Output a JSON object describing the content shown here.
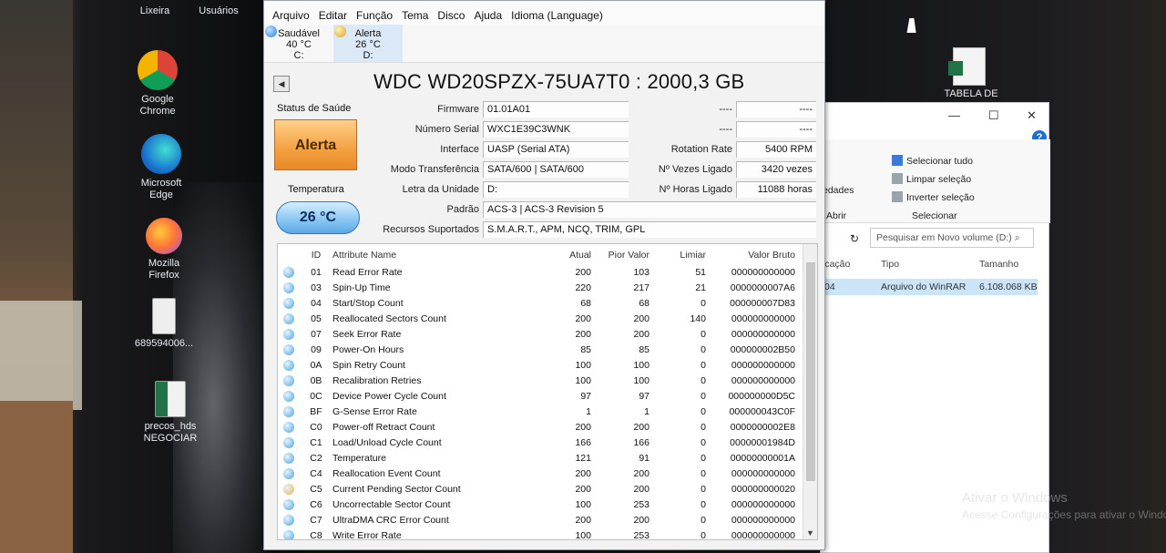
{
  "desktop": {
    "icons": [
      {
        "label1": "Lixeira",
        "label2": ""
      },
      {
        "label1": "Usuários",
        "label2": ""
      },
      {
        "label1": "Google",
        "label2": "Chrome"
      },
      {
        "label1": "Microsoft",
        "label2": "Edge"
      },
      {
        "label1": "Mozilla",
        "label2": "Firefox"
      },
      {
        "label1": "689594006...",
        "label2": ""
      },
      {
        "label1": "precos_hds",
        "label2": "NEGOCIAR"
      },
      {
        "label1": "TABELA DE",
        "label2": ""
      }
    ],
    "watermark": "Ativar o Windows",
    "watermark2": "Acesse Configurações para ativar o Windows."
  },
  "cdi": {
    "menu": [
      "Arquivo",
      "Editar",
      "Função",
      "Tema",
      "Disco",
      "Ajuda",
      "Idioma (Language)"
    ],
    "disks": [
      {
        "status": "Saudável",
        "temp": "40 °C",
        "letter": "C:",
        "color": "#2c7ed6"
      },
      {
        "status": "Alerta",
        "temp": "26 °C",
        "letter": "D:",
        "color": "#e0a020"
      }
    ],
    "title": "WDC WD20SPZX-75UA7T0 : 2000,3 GB",
    "health_label": "Status de Saúde",
    "health_value": "Alerta",
    "temp_label": "Temperatura",
    "temp_value": "26 °C",
    "fields": {
      "firmware": {
        "label": "Firmware",
        "value": "01.01A01"
      },
      "serial": {
        "label": "Número Serial",
        "value": "WXC1E39C3WNK"
      },
      "interface": {
        "label": "Interface",
        "value": "UASP (Serial ATA)"
      },
      "transfer": {
        "label": "Modo Transferência",
        "value": "SATA/600 | SATA/600"
      },
      "drive_letter": {
        "label": "Letra da Unidade",
        "value": "D:"
      },
      "standard": {
        "label": "Padrão",
        "value": "ACS-3 | ACS-3 Revision 5"
      },
      "features": {
        "label": "Recursos Suportados",
        "value": "S.M.A.R.T., APM, NCQ, TRIM, GPL"
      },
      "right1": {
        "label": "----",
        "value": "----"
      },
      "right2": {
        "label": "----",
        "value": "----"
      },
      "rotation": {
        "label": "Rotation Rate",
        "value": "5400 RPM"
      },
      "power_count": {
        "label": "Nº Vezes Ligado",
        "value": "3420 vezes"
      },
      "power_hours": {
        "label": "Nº Horas Ligado",
        "value": "11088 horas"
      }
    },
    "smart_headers": {
      "id": "ID",
      "name": "Attribute Name",
      "current": "Atual",
      "worst": "Pior Valor",
      "threshold": "Limiar",
      "raw": "Valor Bruto"
    },
    "smart_rows": [
      {
        "id": "01",
        "name": "Read Error Rate",
        "current": "200",
        "worst": "103",
        "threshold": "51",
        "raw": "000000000000",
        "status": "good"
      },
      {
        "id": "03",
        "name": "Spin-Up Time",
        "current": "220",
        "worst": "217",
        "threshold": "21",
        "raw": "0000000007A6",
        "status": "good"
      },
      {
        "id": "04",
        "name": "Start/Stop Count",
        "current": "68",
        "worst": "68",
        "threshold": "0",
        "raw": "000000007D83",
        "status": "good"
      },
      {
        "id": "05",
        "name": "Reallocated Sectors Count",
        "current": "200",
        "worst": "200",
        "threshold": "140",
        "raw": "000000000000",
        "status": "good"
      },
      {
        "id": "07",
        "name": "Seek Error Rate",
        "current": "200",
        "worst": "200",
        "threshold": "0",
        "raw": "000000000000",
        "status": "good"
      },
      {
        "id": "09",
        "name": "Power-On Hours",
        "current": "85",
        "worst": "85",
        "threshold": "0",
        "raw": "000000002B50",
        "status": "good"
      },
      {
        "id": "0A",
        "name": "Spin Retry Count",
        "current": "100",
        "worst": "100",
        "threshold": "0",
        "raw": "000000000000",
        "status": "good"
      },
      {
        "id": "0B",
        "name": "Recalibration Retries",
        "current": "100",
        "worst": "100",
        "threshold": "0",
        "raw": "000000000000",
        "status": "good"
      },
      {
        "id": "0C",
        "name": "Device Power Cycle Count",
        "current": "97",
        "worst": "97",
        "threshold": "0",
        "raw": "000000000D5C",
        "status": "good"
      },
      {
        "id": "BF",
        "name": "G-Sense Error Rate",
        "current": "1",
        "worst": "1",
        "threshold": "0",
        "raw": "000000043C0F",
        "status": "good"
      },
      {
        "id": "C0",
        "name": "Power-off Retract Count",
        "current": "200",
        "worst": "200",
        "threshold": "0",
        "raw": "0000000002E8",
        "status": "good"
      },
      {
        "id": "C1",
        "name": "Load/Unload Cycle Count",
        "current": "166",
        "worst": "166",
        "threshold": "0",
        "raw": "00000001984D",
        "status": "good"
      },
      {
        "id": "C2",
        "name": "Temperature",
        "current": "121",
        "worst": "91",
        "threshold": "0",
        "raw": "00000000001A",
        "status": "good"
      },
      {
        "id": "C4",
        "name": "Reallocation Event Count",
        "current": "200",
        "worst": "200",
        "threshold": "0",
        "raw": "000000000000",
        "status": "good"
      },
      {
        "id": "C5",
        "name": "Current Pending Sector Count",
        "current": "200",
        "worst": "200",
        "threshold": "0",
        "raw": "000000000020",
        "status": "caution"
      },
      {
        "id": "C6",
        "name": "Uncorrectable Sector Count",
        "current": "100",
        "worst": "253",
        "threshold": "0",
        "raw": "000000000000",
        "status": "good"
      },
      {
        "id": "C7",
        "name": "UltraDMA CRC Error Count",
        "current": "200",
        "worst": "200",
        "threshold": "0",
        "raw": "000000000000",
        "status": "good"
      },
      {
        "id": "C8",
        "name": "Write Error Rate",
        "current": "100",
        "worst": "253",
        "threshold": "0",
        "raw": "000000000000",
        "status": "good"
      }
    ],
    "colors": {
      "good": "#4aa3df",
      "caution": "#f0b040"
    }
  },
  "explorer": {
    "ribbon": {
      "select_all": "Selecionar tudo",
      "clear": "Limpar seleção",
      "invert": "Inverter seleção",
      "group_open": "Abrir",
      "group_select": "Selecionar",
      "properties": "edades"
    },
    "search_placeholder": "Pesquisar em Novo volume (D:)",
    "columns": {
      "location": "icação",
      "type": "Tipo",
      "size": "Tamanho"
    },
    "row": {
      "location": "04",
      "type": "Arquivo do WinRAR",
      "size": "6.108.068 KB"
    }
  }
}
